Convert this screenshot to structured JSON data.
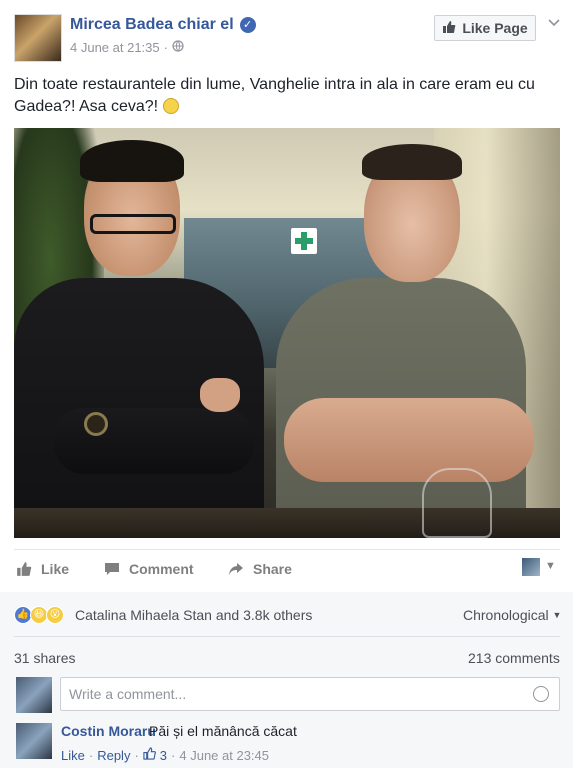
{
  "post": {
    "page_name": "Mircea Badea chiar el",
    "timestamp": "4 June at 21:35",
    "like_page_label": "Like Page",
    "text_main": "Din toate restaurantele din lume, Vanghelie intra in ala in care eram eu cu Gadea?! Asa ceva?!"
  },
  "actions": {
    "like": "Like",
    "comment": "Comment",
    "share": "Share"
  },
  "reactions": {
    "summary": "Catalina Mihaela Stan and 3.8k others",
    "sort": "Chronological",
    "shares": "31 shares",
    "comments": "213 comments"
  },
  "comment_input": {
    "placeholder": "Write a comment..."
  },
  "comments": [
    {
      "author": "Costin Moraru",
      "text": "Păi și el mănâncă căcat",
      "like": "Like",
      "reply": "Reply",
      "reactions": "3",
      "time": "4 June at 23:45"
    }
  ],
  "colors": {
    "link": "#365899",
    "meta": "#90949c",
    "verified": "#4267b2"
  }
}
